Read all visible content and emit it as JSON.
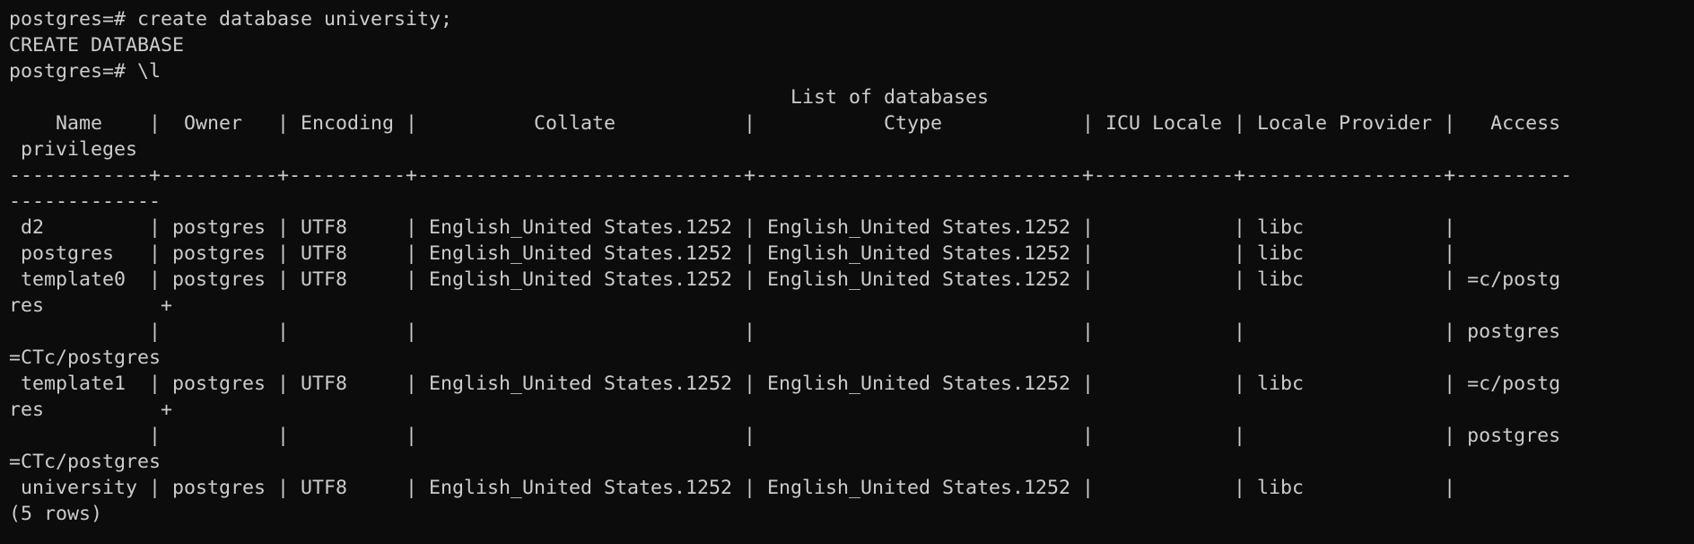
{
  "terminal": {
    "lines": [
      "postgres=# create database university;",
      "CREATE DATABASE",
      "postgres=# \\l",
      "                                                                   List of databases",
      "    Name    |  Owner   | Encoding |          Collate           |           Ctype            | ICU Locale | Locale Provider |   Access",
      " privileges",
      "------------+----------+----------+----------------------------+----------------------------+------------+-----------------+----------",
      "-------------",
      " d2         | postgres | UTF8     | English_United States.1252 | English_United States.1252 |            | libc            |",
      " postgres   | postgres | UTF8     | English_United States.1252 | English_United States.1252 |            | libc            |",
      " template0  | postgres | UTF8     | English_United States.1252 | English_United States.1252 |            | libc            | =c/postg",
      "res          +",
      "            |          |          |                            |                            |            |                 | postgres",
      "=CTc/postgres",
      " template1  | postgres | UTF8     | English_United States.1252 | English_United States.1252 |            | libc            | =c/postg",
      "res          +",
      "            |          |          |                            |                            |            |                 | postgres",
      "=CTc/postgres",
      " university | postgres | UTF8     | English_United States.1252 | English_United States.1252 |            | libc            |",
      "(5 rows)"
    ]
  },
  "colors": {
    "background": "#0c0c0c",
    "foreground": "#cccccc"
  }
}
